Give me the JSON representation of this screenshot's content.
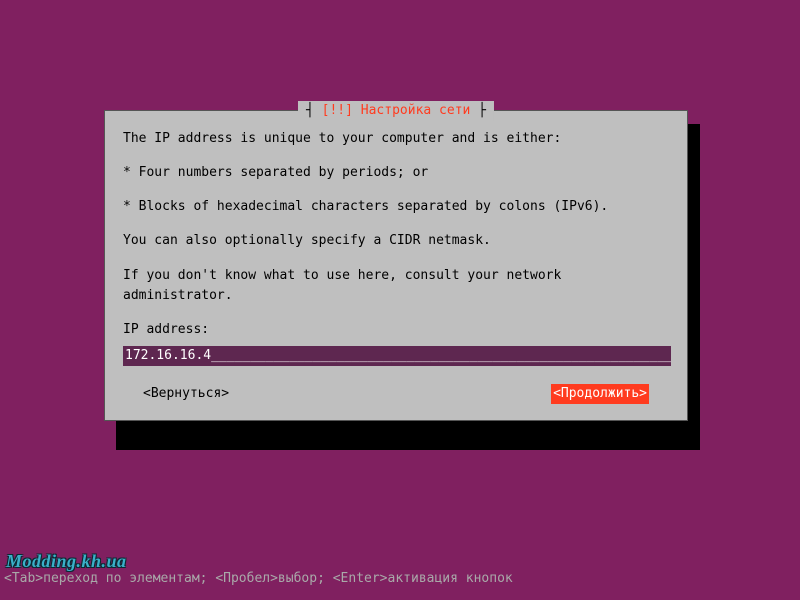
{
  "dialog": {
    "title_prefix": "[!!] ",
    "title_text": "Настройка сети",
    "intro": "The IP address is unique to your computer and is either:",
    "bullet1": "* Four numbers separated by periods; or",
    "bullet2": "* Blocks of hexadecimal characters separated by colons (IPv6).",
    "cidr": "You can also optionally specify a CIDR netmask.",
    "consult": "If you don't know what to use here, consult your network administrator.",
    "label": "IP address:",
    "ip_value": "172.16.16.4",
    "ip_fill": "______________________________________________________________",
    "back": "<Вернуться>",
    "continue": "<Продолжить>"
  },
  "hints": "<Tab>переход по элементам; <Пробел>выбор; <Enter>активация кнопок",
  "watermark": "Modding.kh.ua"
}
